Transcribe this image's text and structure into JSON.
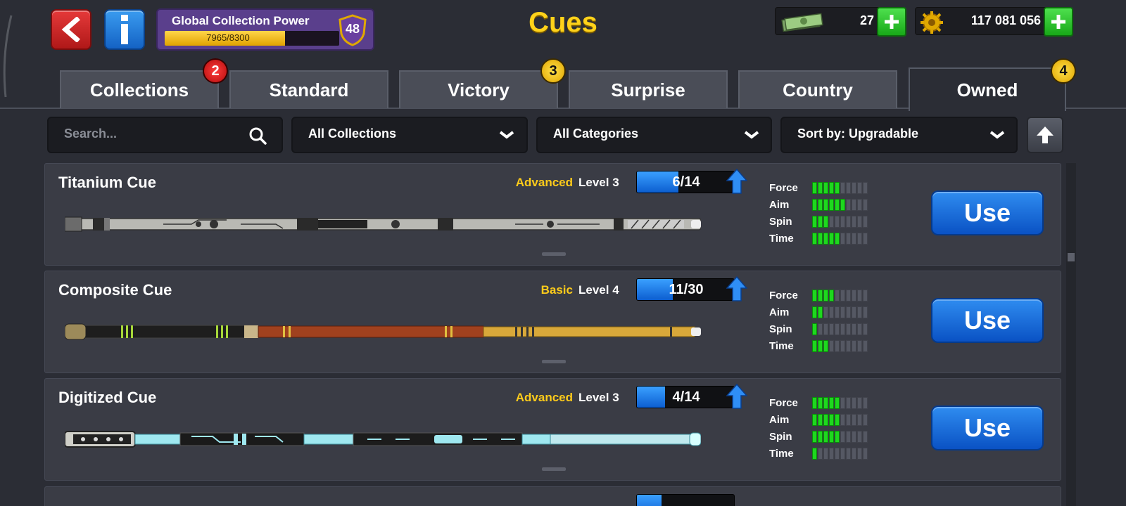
{
  "header": {
    "title": "Cues",
    "collection_power": {
      "label": "Global Collection Power",
      "progress_text": "7965/8300",
      "current": 7965,
      "max": 8300,
      "level": "48"
    },
    "cash": {
      "value": "27",
      "icon": "cash-icon"
    },
    "coins": {
      "value": "117 081 056",
      "icon": "coin-gear-icon"
    }
  },
  "tabs": [
    {
      "label": "Collections",
      "badge": "2",
      "badge_color": "red"
    },
    {
      "label": "Standard",
      "badge": ""
    },
    {
      "label": "Victory",
      "badge": "3",
      "badge_color": "yellow"
    },
    {
      "label": "Surprise",
      "badge": ""
    },
    {
      "label": "Country",
      "badge": ""
    },
    {
      "label": "Owned",
      "badge": "4",
      "badge_color": "yellow",
      "active": true
    }
  ],
  "filters": {
    "search_placeholder": "Search...",
    "collections": "All Collections",
    "categories": "All Categories",
    "sort": "Sort by: Upgradable"
  },
  "cues": [
    {
      "name": "Titanium Cue",
      "rarity": "Advanced",
      "level": "Level 3",
      "progress": "6/14",
      "progress_value": 6,
      "progress_max": 14,
      "stats": {
        "Force": 5,
        "Aim": 6,
        "Spin": 3,
        "Time": 5
      },
      "button": "Use"
    },
    {
      "name": "Composite Cue",
      "rarity": "Basic",
      "level": "Level 4",
      "progress": "11/30",
      "progress_value": 11,
      "progress_max": 30,
      "stats": {
        "Force": 4,
        "Aim": 2,
        "Spin": 1,
        "Time": 3
      },
      "button": "Use"
    },
    {
      "name": "Digitized Cue",
      "rarity": "Advanced",
      "level": "Level 3",
      "progress": "4/14",
      "progress_value": 4,
      "progress_max": 14,
      "stats": {
        "Force": 5,
        "Aim": 5,
        "Spin": 5,
        "Time": 1
      },
      "button": "Use"
    }
  ],
  "stat_labels": [
    "Force",
    "Aim",
    "Spin",
    "Time"
  ],
  "stat_max": 10,
  "colors": {
    "title": "#ffd21a",
    "rarity": "#ffcc1a",
    "stat_on": "#1ed81e",
    "use_button": "#1b6fe0"
  }
}
